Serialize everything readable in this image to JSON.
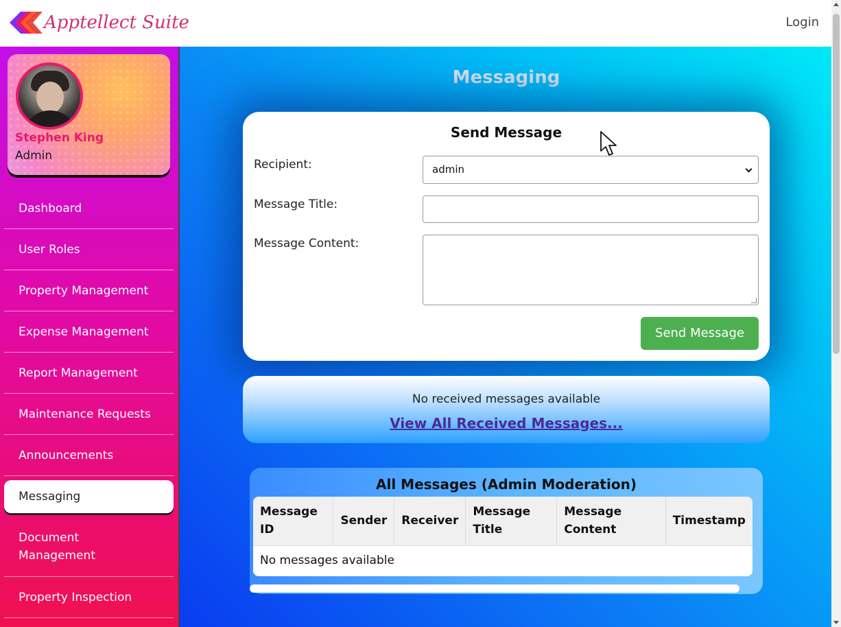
{
  "app": {
    "brand": "Apptellect Suite",
    "login_label": "Login"
  },
  "profile": {
    "name": "Stephen King",
    "role": "Admin"
  },
  "sidebar": {
    "items": [
      {
        "label": "Dashboard"
      },
      {
        "label": "User Roles"
      },
      {
        "label": "Property Management"
      },
      {
        "label": "Expense Management"
      },
      {
        "label": "Report Management"
      },
      {
        "label": "Maintenance Requests"
      },
      {
        "label": "Announcements"
      },
      {
        "label": "Messaging",
        "active": true
      },
      {
        "label": "Document Management"
      },
      {
        "label": "Property Inspection"
      }
    ]
  },
  "page": {
    "title": "Messaging"
  },
  "send_form": {
    "title": "Send Message",
    "recipient_label": "Recipient:",
    "recipient_value": "admin",
    "title_label": "Message Title:",
    "title_value": "",
    "content_label": "Message Content:",
    "content_value": "",
    "send_label": "Send Message"
  },
  "received": {
    "empty_text": "No received messages available",
    "view_all_link": "View All Received Messages..."
  },
  "moderation": {
    "title": "All Messages (Admin Moderation)",
    "columns": [
      "Message ID",
      "Sender",
      "Receiver",
      "Message Title",
      "Message Content",
      "Timestamp"
    ],
    "empty_text": "No messages available"
  },
  "colors": {
    "accent_pink": "#e8196a",
    "send_green": "#4caf50",
    "link_purple": "#4b2a9a"
  }
}
